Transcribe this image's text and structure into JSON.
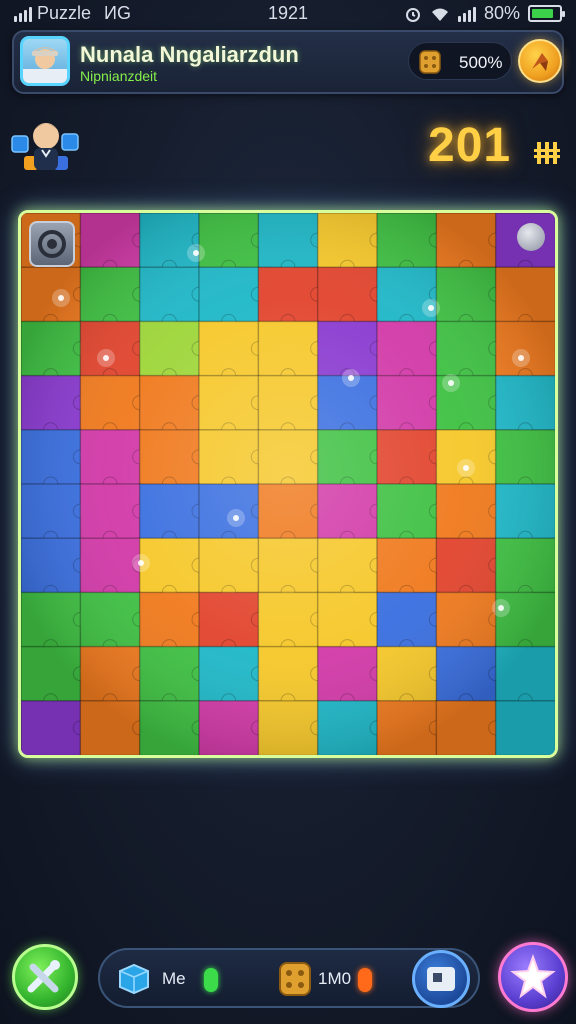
{
  "status_bar": {
    "carrier": "Puzzle",
    "network": "ИG",
    "time": "1921",
    "battery_text": "80%",
    "battery_level": 0.8,
    "icons": [
      "signal-icon",
      "alarm-icon",
      "wifi-icon",
      "battery-icon"
    ]
  },
  "header": {
    "title": "Nunala Nngaliarzdun",
    "subtitle": "Nipnianzdeit",
    "coins": "500%",
    "icons": [
      "avatar",
      "coin-icon",
      "shop-icon"
    ]
  },
  "timer": {
    "value": "201",
    "glyph": "pause-icon"
  },
  "board": {
    "rows": 9,
    "cols": 9,
    "colors": {
      "green": "#3fc143",
      "orange": "#f07a1e",
      "yellow": "#f6c82a",
      "magenta": "#d23aa8",
      "blue": "#3a6fe0",
      "teal": "#1fb8c8",
      "purple": "#8a3ad0",
      "lime": "#9ed63a",
      "red": "#e2452e"
    },
    "tiles": [
      [
        "orange",
        "magenta",
        "teal",
        "green",
        "teal",
        "yellow",
        "green",
        "orange",
        "purple"
      ],
      [
        "orange",
        "green",
        "teal",
        "teal",
        "red",
        "red",
        "teal",
        "green",
        "orange"
      ],
      [
        "green",
        "red",
        "lime",
        "yellow",
        "yellow",
        "purple",
        "magenta",
        "green",
        "orange"
      ],
      [
        "purple",
        "orange",
        "orange",
        "yellow",
        "yellow",
        "blue",
        "magenta",
        "green",
        "teal"
      ],
      [
        "blue",
        "magenta",
        "orange",
        "yellow",
        "yellow",
        "green",
        "red",
        "yellow",
        "green"
      ],
      [
        "blue",
        "magenta",
        "blue",
        "blue",
        "orange",
        "magenta",
        "green",
        "orange",
        "teal"
      ],
      [
        "blue",
        "magenta",
        "yellow",
        "yellow",
        "yellow",
        "yellow",
        "orange",
        "red",
        "green"
      ],
      [
        "green",
        "green",
        "orange",
        "red",
        "yellow",
        "yellow",
        "blue",
        "orange",
        "green"
      ],
      [
        "green",
        "orange",
        "green",
        "teal",
        "yellow",
        "magenta",
        "yellow",
        "blue",
        "teal"
      ],
      [
        "purple",
        "orange",
        "green",
        "magenta",
        "yellow",
        "teal",
        "orange",
        "orange",
        "teal"
      ]
    ],
    "icons": [
      "settings-icon",
      "pin-icon"
    ]
  },
  "bottom_bar": {
    "piece_label": "Me",
    "coin_label": "1М0",
    "buttons": [
      "play-button",
      "photo-button",
      "star-button"
    ],
    "indicator_colors": {
      "left": "#3cdb4a",
      "right": "#ff6a1a"
    }
  }
}
